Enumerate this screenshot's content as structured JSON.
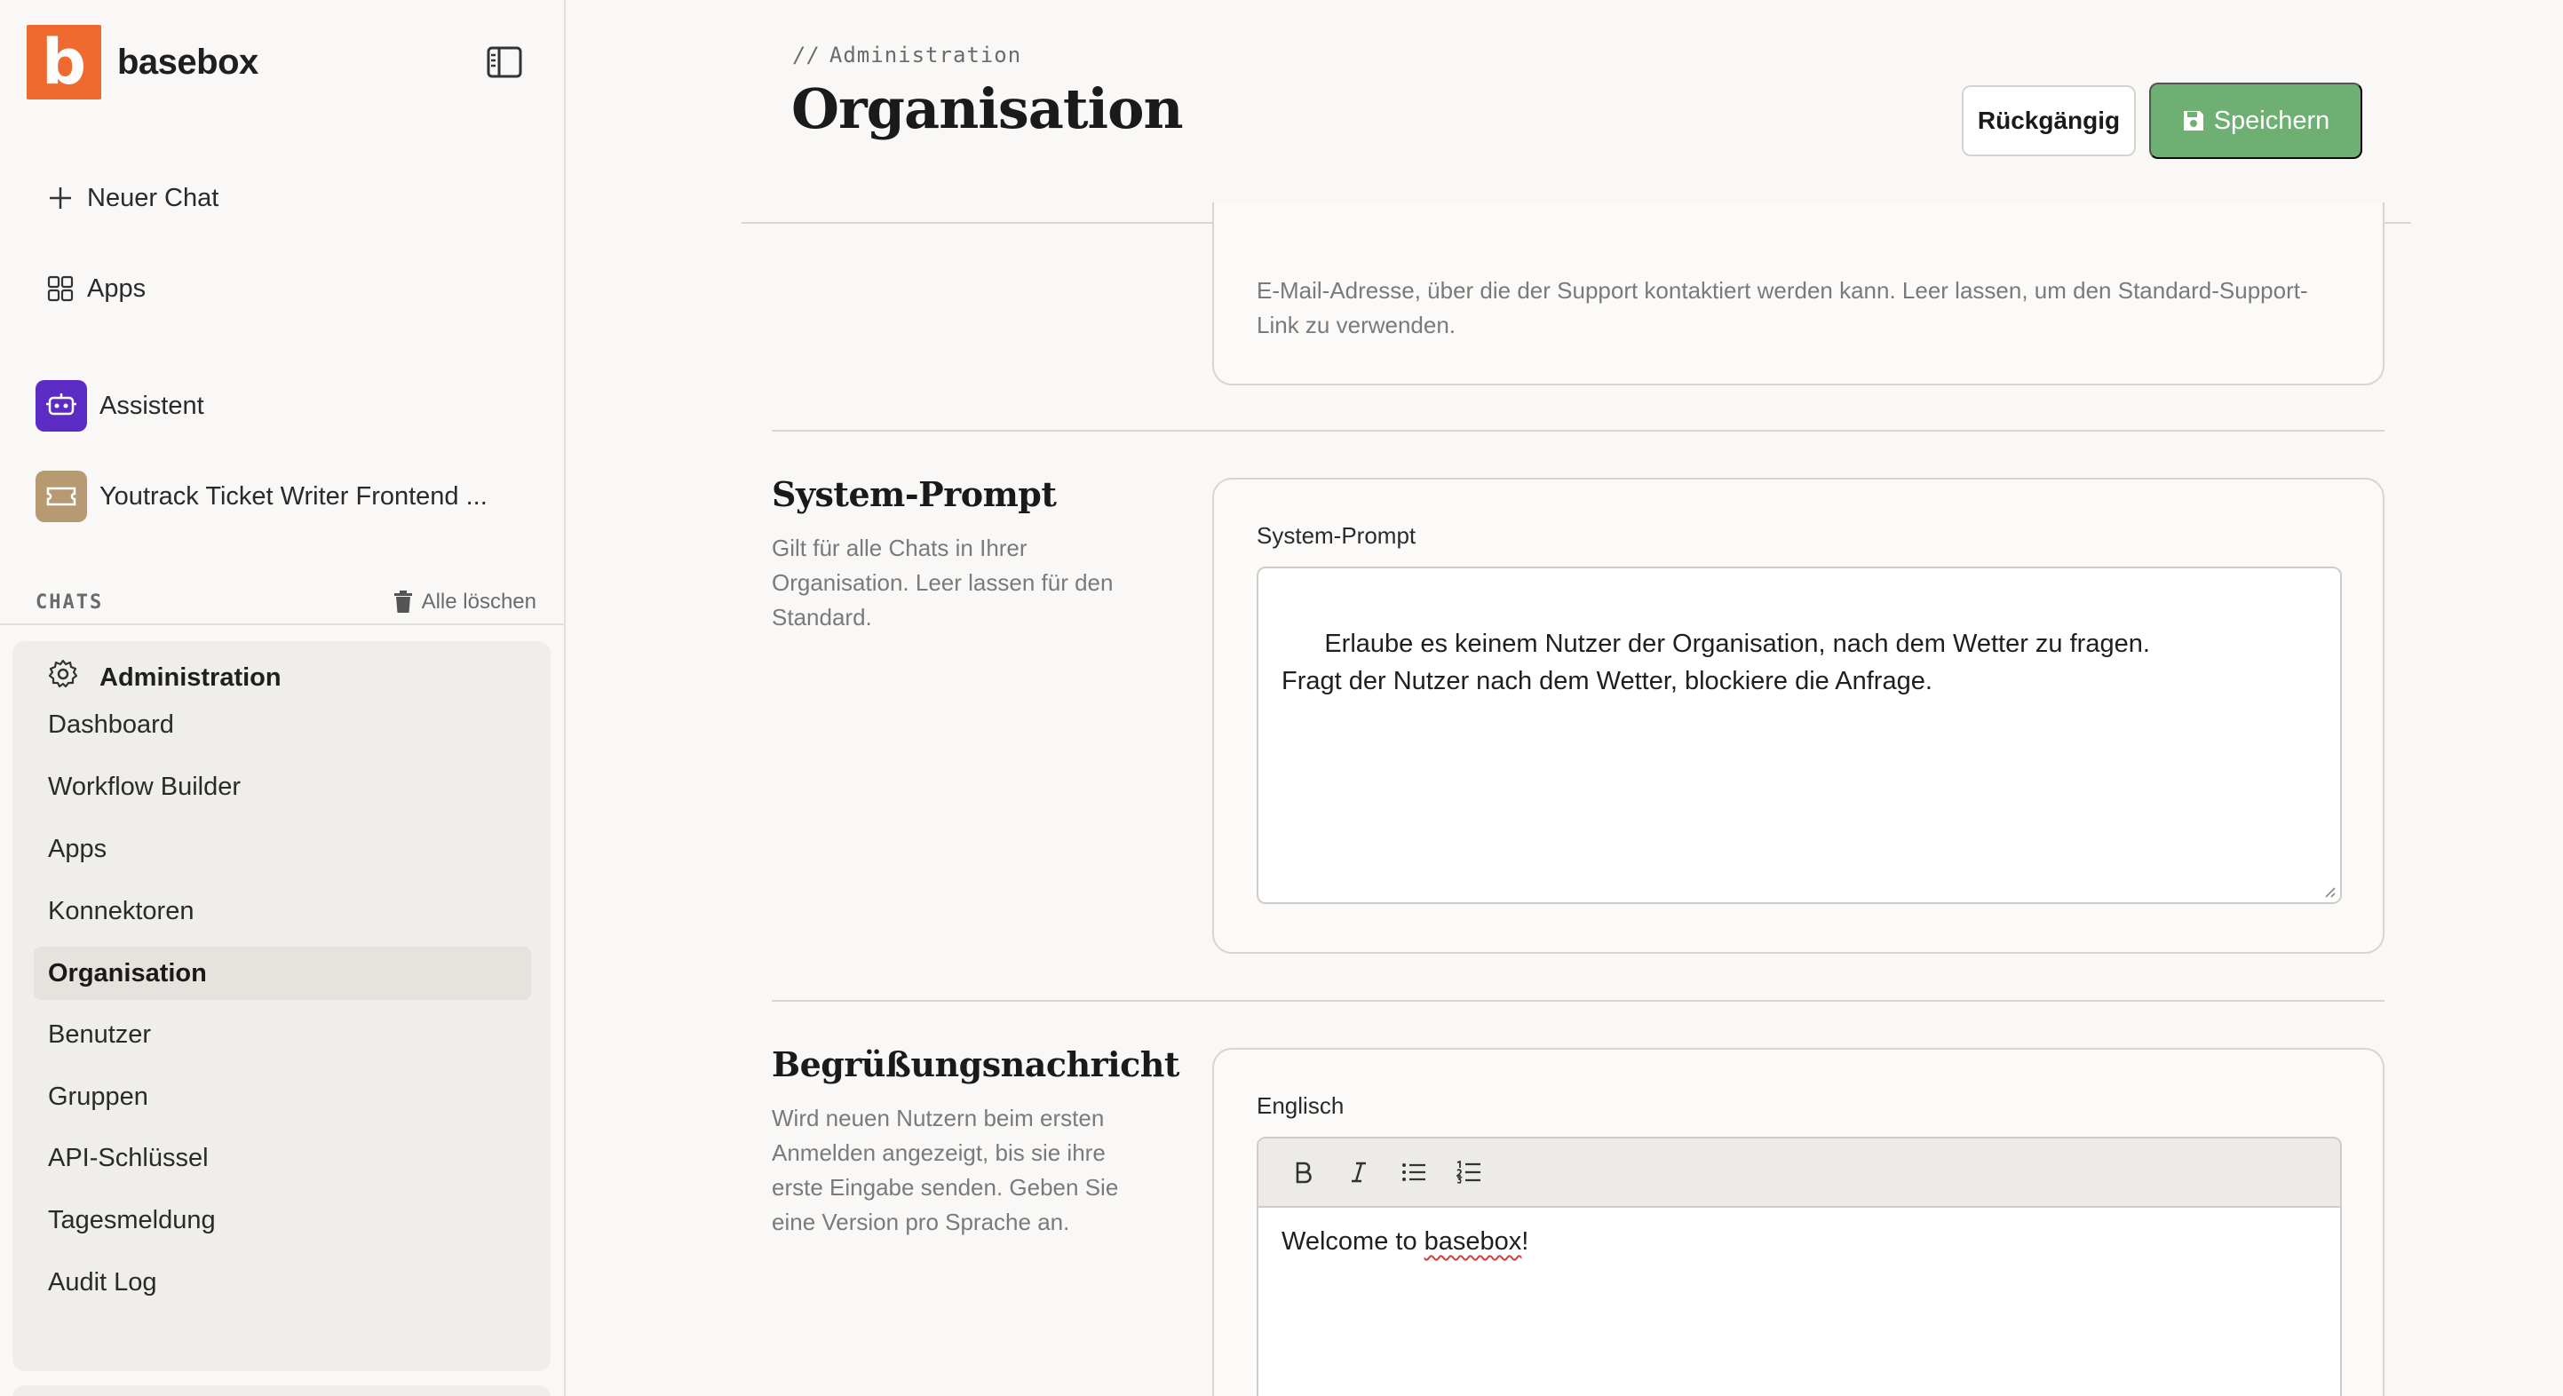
{
  "brand": {
    "logo_letter": "b",
    "name": "basebox"
  },
  "sidebar": {
    "new_chat": "Neuer Chat",
    "apps": "Apps",
    "agents": [
      {
        "label": "Assistent",
        "color": "#5b2bc4"
      },
      {
        "label": "Youtrack Ticket Writer Frontend ...",
        "color": "#b89a72"
      }
    ],
    "chats_label": "CHATS",
    "clear_all": "Alle löschen",
    "admin": {
      "title": "Administration",
      "items": [
        {
          "label": "Dashboard"
        },
        {
          "label": "Workflow Builder"
        },
        {
          "label": "Apps"
        },
        {
          "label": "Konnektoren"
        },
        {
          "label": "Organisation",
          "active": true
        },
        {
          "label": "Benutzer"
        },
        {
          "label": "Gruppen"
        },
        {
          "label": "API-Schlüssel"
        },
        {
          "label": "Tagesmeldung"
        },
        {
          "label": "Audit Log"
        }
      ]
    }
  },
  "header": {
    "breadcrumb_prefix": "//",
    "breadcrumb": "Administration",
    "title": "Organisation",
    "undo_label": "Rückgängig",
    "save_label": "Speichern"
  },
  "support_section": {
    "help": "E-Mail-Adresse, über die der Support kontaktiert werden kann. Leer lassen, um den Standard-Support-Link zu verwenden."
  },
  "system_prompt_section": {
    "title": "System-Prompt",
    "description": "Gilt für alle Chats in Ihrer Organisation. Leer lassen für den Standard.",
    "field_label": "System-Prompt",
    "value": "Erlaube es keinem Nutzer der Organisation, nach dem Wetter zu fragen.\nFragt der Nutzer nach dem Wetter, blockiere die Anfrage."
  },
  "welcome_section": {
    "title": "Begrüßungsnachricht",
    "description": "Wird neuen Nutzern beim ersten Anmelden angezeigt, bis sie ihre erste Eingabe senden. Geben Sie eine Version pro Sprache an.",
    "field_label": "Englisch",
    "content_prefix": "Welcome to ",
    "content_word": "basebox",
    "content_suffix": "!"
  },
  "colors": {
    "brand": "#ee6a2e",
    "save_button": "#6eaf73",
    "active_item_bg": "#e6e3de"
  }
}
